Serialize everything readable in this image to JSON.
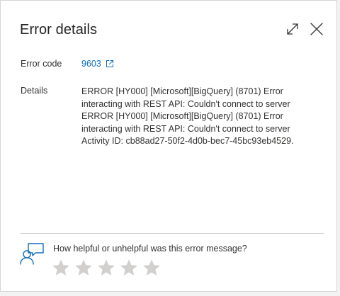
{
  "dialog": {
    "title": "Error details"
  },
  "error": {
    "code_label": "Error code",
    "code_value": "9603",
    "details_label": "Details",
    "details_text": "ERROR [HY000] [Microsoft][BigQuery] (8701) Error interacting with REST API: Couldn't connect to server ERROR [HY000] [Microsoft][BigQuery] (8701) Error interacting with REST API: Couldn't connect to server Activity ID: cb88ad27-50f2-4d0b-bec7-45bc93eb4529."
  },
  "feedback": {
    "question": "How helpful or unhelpful was this error message?",
    "stars": [
      {
        "value": 1
      },
      {
        "value": 2
      },
      {
        "value": 3
      },
      {
        "value": 4
      },
      {
        "value": 5
      }
    ]
  },
  "icons": {
    "expand": "expand-icon",
    "close": "close-icon",
    "external_link": "external-link-icon",
    "feedback": "feedback-person-icon",
    "star": "star-icon"
  },
  "colors": {
    "link": "#0f6cbd",
    "feedback_icon": "#0f6cbd",
    "star_empty": "#d2d0ce",
    "text": "#323130",
    "divider": "#c8c6c4"
  }
}
